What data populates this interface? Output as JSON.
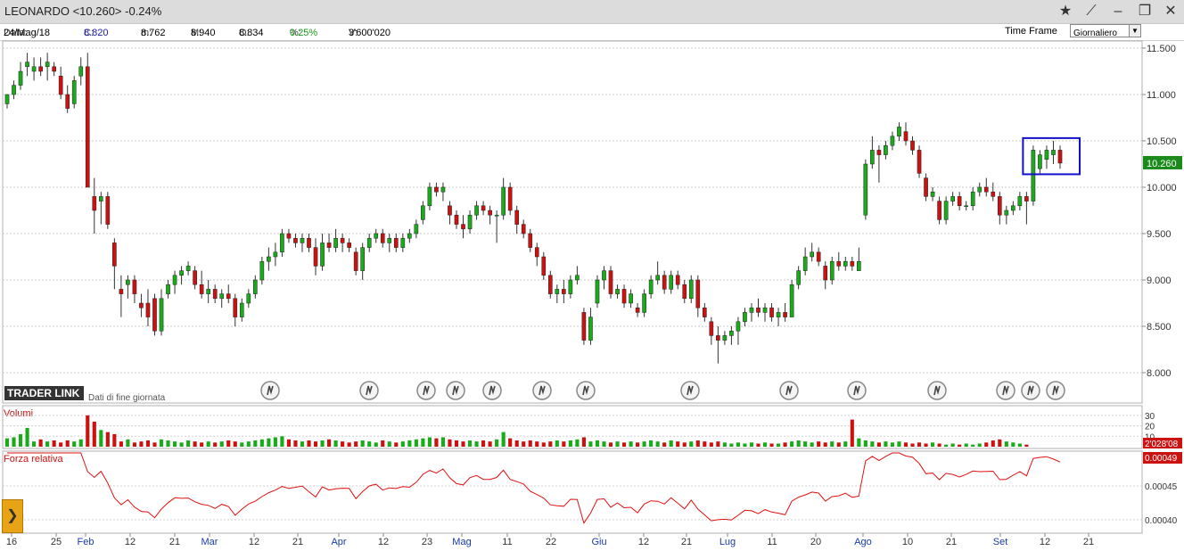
{
  "window": {
    "title": "LEONARDO <10.260> -0.24%",
    "controls": [
      "star-icon",
      "pin-icon",
      "minimize-icon",
      "maximize-icon",
      "close-icon"
    ]
  },
  "info": {
    "data_label": "Data:",
    "data_value": "24/Mag/18",
    "c_label": "C:",
    "c_value": "8.820",
    "m_label": "m:",
    "m_value": "8.762",
    "M_label": "M:",
    "M_value": "8.940",
    "o_label": "O:",
    "o_value": "8.834",
    "pct_label": "%:",
    "pct_value": "0.25%",
    "v_label": "V:",
    "v_value": "3'600'020",
    "timeframe_label": "Time Frame",
    "timeframe_value": "Giornaliero"
  },
  "branding": {
    "logo": "TRADER LINK",
    "subtitle": "Dati di fine giornata"
  },
  "panels": {
    "volume_label": "Volumi",
    "volume_ticks": [
      "30",
      "20",
      "10"
    ],
    "volume_badge": "2'028'08",
    "rs_label": "Forza relativa",
    "rs_ticks": [
      "0.00045",
      "0.00040"
    ],
    "rs_badge": "0.00049"
  },
  "price_badge": "10.260",
  "colors": {
    "up": "#1aab1a",
    "down": "#cc1111",
    "rs_line": "#e01010",
    "box": "#1010cc",
    "badge": "#1a8a1a"
  },
  "chart_data": {
    "type": "candlestick",
    "y_ticks": [
      "11.500",
      "11.000",
      "10.500",
      "10.000",
      "9.500",
      "9.000",
      "8.500",
      "8.000"
    ],
    "ylim": [
      8.0,
      11.5
    ],
    "x_ticks": [
      "16",
      "25",
      "Feb",
      "12",
      "21",
      "Mar",
      "12",
      "21",
      "Apr",
      "12",
      "23",
      "Mag",
      "11",
      "22",
      "Giu",
      "12",
      "21",
      "Lug",
      "11",
      "20",
      "Ago",
      "10",
      "21",
      "Set",
      "12",
      "21"
    ],
    "highlight": {
      "from_close": 9.9,
      "to_close": 10.3,
      "note": "blue rectangle around last sessions"
    },
    "candles": [
      [
        10.9,
        11.0,
        10.85,
        11.0
      ],
      [
        11.0,
        11.15,
        10.95,
        11.1
      ],
      [
        11.1,
        11.35,
        11.05,
        11.25
      ],
      [
        11.3,
        11.45,
        11.2,
        11.35
      ],
      [
        11.25,
        11.4,
        11.15,
        11.3
      ],
      [
        11.3,
        11.4,
        11.2,
        11.25
      ],
      [
        11.3,
        11.45,
        11.15,
        11.35
      ],
      [
        11.3,
        11.35,
        11.2,
        11.25
      ],
      [
        11.2,
        11.3,
        10.95,
        11.0
      ],
      [
        11.0,
        11.1,
        10.8,
        10.85
      ],
      [
        10.9,
        11.2,
        10.85,
        11.15
      ],
      [
        11.2,
        11.4,
        11.1,
        11.3
      ],
      [
        11.3,
        11.45,
        10.0,
        10.0
      ],
      [
        9.9,
        10.1,
        9.5,
        9.75
      ],
      [
        9.85,
        9.95,
        9.6,
        9.9
      ],
      [
        9.9,
        9.95,
        9.55,
        9.6
      ],
      [
        9.4,
        9.45,
        8.9,
        9.15
      ],
      [
        8.9,
        9.05,
        8.6,
        8.85
      ],
      [
        8.95,
        9.05,
        8.8,
        9.0
      ],
      [
        9.0,
        9.05,
        8.75,
        8.85
      ],
      [
        8.75,
        8.85,
        8.6,
        8.7
      ],
      [
        8.75,
        8.9,
        8.5,
        8.6
      ],
      [
        8.8,
        8.85,
        8.4,
        8.45
      ],
      [
        8.45,
        8.9,
        8.4,
        8.8
      ],
      [
        8.85,
        9.0,
        8.8,
        8.95
      ],
      [
        8.95,
        9.1,
        8.85,
        9.05
      ],
      [
        9.05,
        9.15,
        8.95,
        9.1
      ],
      [
        9.1,
        9.2,
        9.05,
        9.15
      ],
      [
        9.1,
        9.15,
        8.9,
        8.95
      ],
      [
        8.95,
        9.1,
        8.8,
        8.85
      ],
      [
        8.85,
        9.0,
        8.75,
        8.9
      ],
      [
        8.9,
        8.95,
        8.75,
        8.8
      ],
      [
        8.8,
        8.9,
        8.7,
        8.85
      ],
      [
        8.85,
        8.95,
        8.75,
        8.8
      ],
      [
        8.8,
        8.85,
        8.5,
        8.6
      ],
      [
        8.6,
        8.8,
        8.55,
        8.75
      ],
      [
        8.75,
        8.9,
        8.7,
        8.85
      ],
      [
        8.85,
        9.05,
        8.8,
        9.0
      ],
      [
        9.0,
        9.25,
        8.95,
        9.2
      ],
      [
        9.2,
        9.35,
        9.1,
        9.25
      ],
      [
        9.25,
        9.4,
        9.15,
        9.3
      ],
      [
        9.3,
        9.55,
        9.25,
        9.5
      ],
      [
        9.5,
        9.55,
        9.4,
        9.45
      ],
      [
        9.45,
        9.5,
        9.35,
        9.4
      ],
      [
        9.4,
        9.5,
        9.3,
        9.45
      ],
      [
        9.45,
        9.5,
        9.3,
        9.35
      ],
      [
        9.35,
        9.45,
        9.05,
        9.15
      ],
      [
        9.15,
        9.5,
        9.1,
        9.4
      ],
      [
        9.4,
        9.5,
        9.3,
        9.35
      ],
      [
        9.35,
        9.55,
        9.3,
        9.45
      ],
      [
        9.45,
        9.5,
        9.3,
        9.4
      ],
      [
        9.4,
        9.45,
        9.3,
        9.35
      ],
      [
        9.3,
        9.35,
        9.05,
        9.1
      ],
      [
        9.1,
        9.4,
        9.0,
        9.35
      ],
      [
        9.35,
        9.5,
        9.3,
        9.45
      ],
      [
        9.45,
        9.55,
        9.4,
        9.5
      ],
      [
        9.5,
        9.55,
        9.35,
        9.4
      ],
      [
        9.4,
        9.5,
        9.3,
        9.45
      ],
      [
        9.45,
        9.5,
        9.3,
        9.35
      ],
      [
        9.35,
        9.5,
        9.3,
        9.45
      ],
      [
        9.45,
        9.55,
        9.4,
        9.5
      ],
      [
        9.5,
        9.65,
        9.45,
        9.6
      ],
      [
        9.65,
        9.85,
        9.6,
        9.8
      ],
      [
        9.8,
        10.05,
        9.75,
        10.0
      ],
      [
        10.0,
        10.05,
        9.9,
        9.95
      ],
      [
        9.95,
        10.05,
        9.85,
        10.0
      ],
      [
        9.8,
        9.85,
        9.6,
        9.7
      ],
      [
        9.7,
        9.75,
        9.55,
        9.6
      ],
      [
        9.6,
        9.7,
        9.45,
        9.55
      ],
      [
        9.55,
        9.75,
        9.5,
        9.7
      ],
      [
        9.7,
        9.85,
        9.65,
        9.8
      ],
      [
        9.8,
        9.85,
        9.7,
        9.75
      ],
      [
        9.75,
        9.8,
        9.6,
        9.7
      ],
      [
        9.7,
        9.75,
        9.4,
        9.7
      ],
      [
        9.7,
        10.1,
        9.65,
        10.0
      ],
      [
        10.0,
        10.05,
        9.7,
        9.75
      ],
      [
        9.75,
        9.8,
        9.5,
        9.6
      ],
      [
        9.6,
        9.65,
        9.45,
        9.5
      ],
      [
        9.5,
        9.55,
        9.3,
        9.35
      ],
      [
        9.35,
        9.4,
        9.15,
        9.25
      ],
      [
        9.25,
        9.3,
        9.0,
        9.05
      ],
      [
        9.05,
        9.1,
        8.8,
        8.85
      ],
      [
        8.85,
        8.95,
        8.75,
        8.9
      ],
      [
        8.9,
        9.0,
        8.75,
        8.85
      ],
      [
        8.85,
        9.05,
        8.8,
        9.0
      ],
      [
        9.0,
        9.15,
        8.95,
        9.05
      ],
      [
        8.65,
        8.7,
        8.3,
        8.35
      ],
      [
        8.35,
        8.7,
        8.3,
        8.6
      ],
      [
        8.75,
        9.05,
        8.7,
        9.0
      ],
      [
        9.0,
        9.15,
        8.9,
        9.1
      ],
      [
        9.1,
        9.15,
        8.8,
        8.85
      ],
      [
        8.85,
        8.95,
        8.8,
        8.9
      ],
      [
        8.9,
        8.95,
        8.7,
        8.75
      ],
      [
        8.75,
        8.9,
        8.7,
        8.85
      ],
      [
        8.7,
        8.75,
        8.6,
        8.65
      ],
      [
        8.65,
        8.9,
        8.6,
        8.85
      ],
      [
        8.85,
        9.05,
        8.8,
        9.0
      ],
      [
        9.0,
        9.2,
        8.95,
        9.05
      ],
      [
        9.05,
        9.1,
        8.85,
        8.9
      ],
      [
        8.9,
        9.1,
        8.85,
        9.05
      ],
      [
        9.05,
        9.1,
        8.9,
        8.95
      ],
      [
        8.95,
        9.0,
        8.75,
        8.8
      ],
      [
        8.8,
        9.05,
        8.75,
        9.0
      ],
      [
        9.0,
        9.05,
        8.6,
        8.7
      ],
      [
        8.7,
        8.75,
        8.55,
        8.6
      ],
      [
        8.55,
        8.6,
        8.3,
        8.4
      ],
      [
        8.4,
        8.5,
        8.1,
        8.35
      ],
      [
        8.35,
        8.45,
        8.3,
        8.4
      ],
      [
        8.4,
        8.5,
        8.3,
        8.45
      ],
      [
        8.45,
        8.6,
        8.3,
        8.55
      ],
      [
        8.55,
        8.7,
        8.5,
        8.65
      ],
      [
        8.65,
        8.75,
        8.55,
        8.7
      ],
      [
        8.7,
        8.8,
        8.6,
        8.65
      ],
      [
        8.65,
        8.75,
        8.55,
        8.7
      ],
      [
        8.7,
        8.75,
        8.55,
        8.6
      ],
      [
        8.6,
        8.7,
        8.5,
        8.65
      ],
      [
        8.65,
        8.75,
        8.55,
        8.6
      ],
      [
        8.6,
        9.0,
        8.6,
        8.95
      ],
      [
        8.95,
        9.15,
        8.9,
        9.1
      ],
      [
        9.1,
        9.35,
        9.05,
        9.25
      ],
      [
        9.25,
        9.4,
        9.2,
        9.3
      ],
      [
        9.3,
        9.35,
        9.15,
        9.2
      ],
      [
        9.15,
        9.2,
        8.9,
        9.0
      ],
      [
        9.0,
        9.25,
        8.95,
        9.2
      ],
      [
        9.2,
        9.3,
        9.1,
        9.15
      ],
      [
        9.15,
        9.25,
        9.1,
        9.2
      ],
      [
        9.2,
        9.25,
        9.1,
        9.15
      ],
      [
        9.1,
        9.35,
        9.1,
        9.2
      ],
      [
        9.7,
        10.3,
        9.65,
        10.25
      ],
      [
        10.25,
        10.55,
        10.2,
        10.4
      ],
      [
        10.4,
        10.45,
        10.05,
        10.35
      ],
      [
        10.35,
        10.5,
        10.3,
        10.45
      ],
      [
        10.45,
        10.6,
        10.4,
        10.55
      ],
      [
        10.55,
        10.7,
        10.5,
        10.65
      ],
      [
        10.6,
        10.7,
        10.45,
        10.5
      ],
      [
        10.5,
        10.55,
        10.35,
        10.4
      ],
      [
        10.4,
        10.45,
        10.1,
        10.15
      ],
      [
        10.1,
        10.15,
        9.85,
        9.9
      ],
      [
        9.9,
        10.0,
        9.85,
        9.95
      ],
      [
        9.85,
        9.9,
        9.6,
        9.65
      ],
      [
        9.65,
        9.9,
        9.6,
        9.85
      ],
      [
        9.85,
        9.95,
        9.8,
        9.9
      ],
      [
        9.9,
        9.95,
        9.75,
        9.8
      ],
      [
        9.8,
        9.85,
        9.75,
        9.8
      ],
      [
        9.8,
        10.0,
        9.75,
        9.95
      ],
      [
        9.95,
        10.05,
        9.9,
        10.0
      ],
      [
        10.0,
        10.1,
        9.9,
        9.95
      ],
      [
        9.95,
        10.05,
        9.85,
        9.9
      ],
      [
        9.9,
        9.95,
        9.6,
        9.7
      ],
      [
        9.7,
        9.8,
        9.6,
        9.75
      ],
      [
        9.75,
        9.85,
        9.7,
        9.8
      ],
      [
        9.8,
        9.95,
        9.75,
        9.9
      ],
      [
        9.9,
        9.95,
        9.6,
        9.85
      ],
      [
        9.85,
        10.45,
        9.8,
        10.4
      ],
      [
        10.2,
        10.4,
        10.15,
        10.35
      ],
      [
        10.3,
        10.45,
        10.2,
        10.4
      ],
      [
        10.35,
        10.5,
        10.25,
        10.4
      ],
      [
        10.4,
        10.45,
        10.2,
        10.26
      ]
    ],
    "volumes": [
      8,
      9,
      12,
      18,
      5,
      7,
      5,
      6,
      4,
      6,
      5,
      7,
      30,
      24,
      16,
      14,
      12,
      5,
      7,
      4,
      5,
      6,
      4,
      7,
      6,
      5,
      4,
      6,
      5,
      4,
      5,
      4,
      5,
      6,
      5,
      4,
      5,
      6,
      7,
      8,
      9,
      10,
      7,
      6,
      5,
      6,
      5,
      6,
      7,
      6,
      5,
      4,
      5,
      6,
      5,
      4,
      6,
      5,
      4,
      5,
      6,
      7,
      8,
      9,
      8,
      9,
      7,
      6,
      5,
      6,
      5,
      6,
      5,
      7,
      14,
      8,
      6,
      5,
      6,
      5,
      4,
      5,
      6,
      5,
      6,
      7,
      9,
      5,
      6,
      5,
      4,
      5,
      4,
      5,
      4,
      5,
      6,
      5,
      4,
      6,
      5,
      4,
      5,
      6,
      5,
      4,
      5,
      4,
      3,
      4,
      3,
      4,
      3,
      4,
      3,
      3,
      4,
      5,
      6,
      5,
      4,
      5,
      4,
      5,
      4,
      5,
      26,
      8,
      6,
      5,
      4,
      5,
      4,
      5,
      4,
      3,
      4,
      3,
      4,
      3,
      2,
      3,
      2,
      3,
      2,
      3,
      4,
      6,
      7,
      5,
      4,
      3,
      2
    ]
  }
}
